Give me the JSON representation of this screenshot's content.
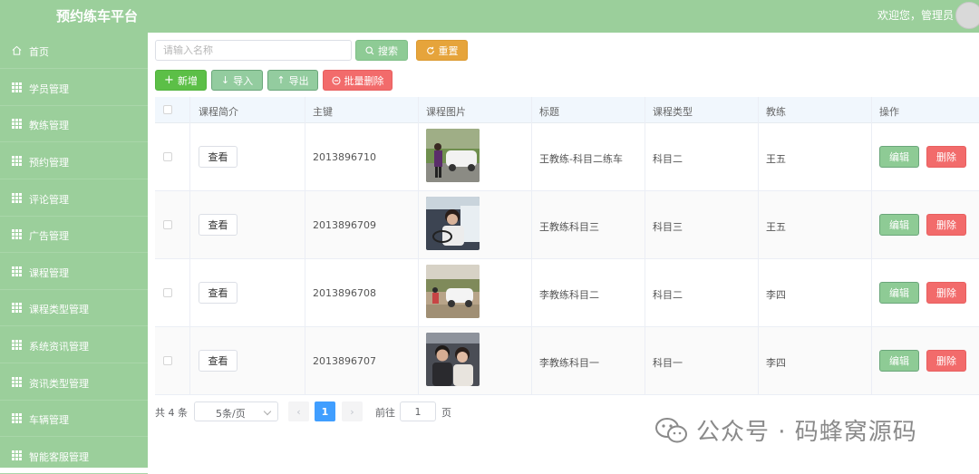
{
  "header": {
    "app_title": "预约练车平台",
    "welcome": "欢迎您，管理员"
  },
  "sidebar": {
    "items": [
      {
        "label": "首页",
        "icon": "home-icon"
      },
      {
        "label": "学员管理",
        "icon": "grid-icon"
      },
      {
        "label": "教练管理",
        "icon": "grid-icon"
      },
      {
        "label": "预约管理",
        "icon": "grid-icon"
      },
      {
        "label": "评论管理",
        "icon": "grid-icon"
      },
      {
        "label": "广告管理",
        "icon": "grid-icon"
      },
      {
        "label": "课程管理",
        "icon": "grid-icon"
      },
      {
        "label": "课程类型管理",
        "icon": "grid-icon"
      },
      {
        "label": "系统资讯管理",
        "icon": "grid-icon"
      },
      {
        "label": "资讯类型管理",
        "icon": "grid-icon"
      },
      {
        "label": "车辆管理",
        "icon": "grid-icon"
      },
      {
        "label": "智能客服管理",
        "icon": "grid-icon"
      }
    ]
  },
  "toolbar": {
    "search_placeholder": "请输入名称",
    "search_value": "",
    "search_label": "搜索",
    "reset_label": "重置",
    "add_label": "新增",
    "import_label": "导入",
    "export_label": "导出",
    "batch_delete_label": "批量删除"
  },
  "table": {
    "columns": [
      "课程简介",
      "主键",
      "课程图片",
      "标题",
      "课程类型",
      "教练",
      "操作"
    ],
    "view_label": "查看",
    "edit_label": "编辑",
    "delete_label": "删除",
    "rows": [
      {
        "id": "2013896710",
        "title": "王教练-科目二练车",
        "type": "科目二",
        "coach": "王五"
      },
      {
        "id": "2013896709",
        "title": "王教练科目三",
        "type": "科目三",
        "coach": "王五"
      },
      {
        "id": "2013896708",
        "title": "李教练科目二",
        "type": "科目二",
        "coach": "李四"
      },
      {
        "id": "2013896707",
        "title": "李教练科目一",
        "type": "科目一",
        "coach": "李四"
      }
    ]
  },
  "pagination": {
    "total_text": "共 4 条",
    "page_size": "5条/页",
    "current_page": "1",
    "goto_label": "前往",
    "goto_value": "1",
    "goto_unit": "页"
  },
  "watermark": {
    "text": "公众号 · 码蜂窝源码"
  },
  "colors": {
    "sidebar": "#9bcf9b",
    "primary": "#409eff",
    "danger": "#f26b6b",
    "warning": "#e6a43b",
    "success": "#5cbf47"
  }
}
